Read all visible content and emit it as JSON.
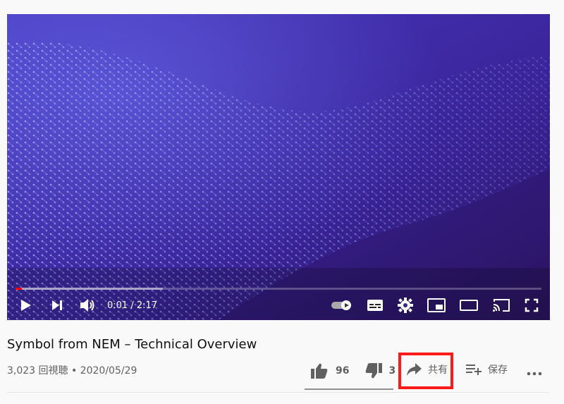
{
  "player": {
    "progress_played_fraction": 0.012,
    "progress_buffer_fraction": 0.28,
    "time_text": "0:01 / 2:17",
    "icons": [
      "play-icon",
      "next-icon",
      "volume-icon",
      "autoplay-toggle-icon",
      "subtitles-icon",
      "settings-icon",
      "miniplayer-icon",
      "theater-icon",
      "cast-icon",
      "fullscreen-icon"
    ]
  },
  "video": {
    "title": "Symbol from NEM – Technical Overview",
    "meta": "3,023 回視聴 • 2020/05/29"
  },
  "actions": {
    "like_count": "96",
    "dislike_count": "3",
    "share_label": "共有",
    "save_label": "保存",
    "like_ratio": 0.97,
    "highlight_color": "#ff1a1a"
  }
}
